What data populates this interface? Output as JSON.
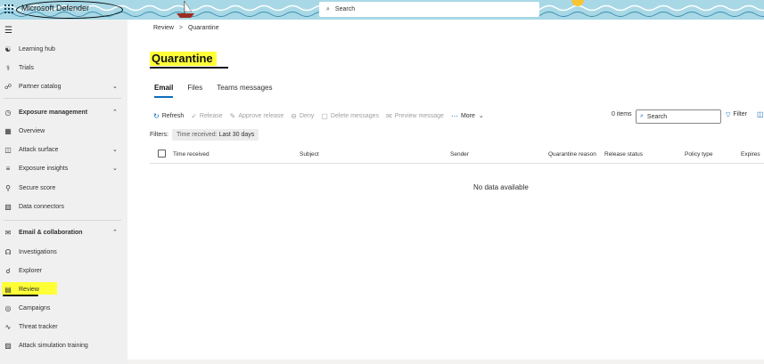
{
  "app": {
    "title": "Microsoft Defender",
    "search_placeholder": "Search"
  },
  "colors": {
    "accent": "#0f6cbd",
    "highlight": "#ffff38",
    "sidebar_bg": "#f0f0f0",
    "banner_bg": "#a8d8e6"
  },
  "sidebar": {
    "items": [
      {
        "label": "Learning hub",
        "icon": "learning-hub-icon"
      },
      {
        "label": "Trials",
        "icon": "trials-icon"
      },
      {
        "label": "Partner catalog",
        "icon": "partner-catalog-icon",
        "chevron": "down"
      },
      {
        "label": "Exposure management",
        "icon": "exposure-management-icon",
        "chevron": "up"
      },
      {
        "label": "Overview",
        "icon": "overview-icon"
      },
      {
        "label": "Attack surface",
        "icon": "attack-surface-icon",
        "chevron": "down"
      },
      {
        "label": "Exposure insights",
        "icon": "exposure-insights-icon",
        "chevron": "down"
      },
      {
        "label": "Secure score",
        "icon": "trophy-icon"
      },
      {
        "label": "Data connectors",
        "icon": "data-connectors-icon"
      },
      {
        "label": "Email & collaboration",
        "icon": "email-icon",
        "chevron": "up"
      },
      {
        "label": "Investigations",
        "icon": "investigations-icon"
      },
      {
        "label": "Explorer",
        "icon": "explorer-icon"
      },
      {
        "label": "Review",
        "icon": "review-icon"
      },
      {
        "label": "Campaigns",
        "icon": "campaigns-icon"
      },
      {
        "label": "Threat tracker",
        "icon": "threat-tracker-icon"
      },
      {
        "label": "Attack simulation training",
        "icon": "attack-simulation-icon"
      }
    ]
  },
  "breadcrumb": {
    "parent": "Review",
    "separator": ">",
    "current": "Quarantine"
  },
  "page": {
    "title": "Quarantine"
  },
  "tabs": [
    {
      "label": "Email",
      "active": true
    },
    {
      "label": "Files",
      "active": false
    },
    {
      "label": "Teams messages",
      "active": false
    }
  ],
  "toolbar": {
    "refresh": "Refresh",
    "release": "Release",
    "approve_release": "Approve release",
    "deny": "Deny",
    "delete_messages": "Delete messages",
    "preview_message": "Preview message",
    "more": "More",
    "items_count": "0 items",
    "search_placeholder": "Search",
    "filter": "Filter"
  },
  "filters": {
    "label": "Filters:",
    "pill_key": "Time received:",
    "pill_value": "Last 30 days"
  },
  "table": {
    "columns": [
      "Time received",
      "Subject",
      "Sender",
      "Quarantine reason",
      "Release status",
      "Policy type",
      "Expires"
    ],
    "empty_text": "No data available"
  }
}
